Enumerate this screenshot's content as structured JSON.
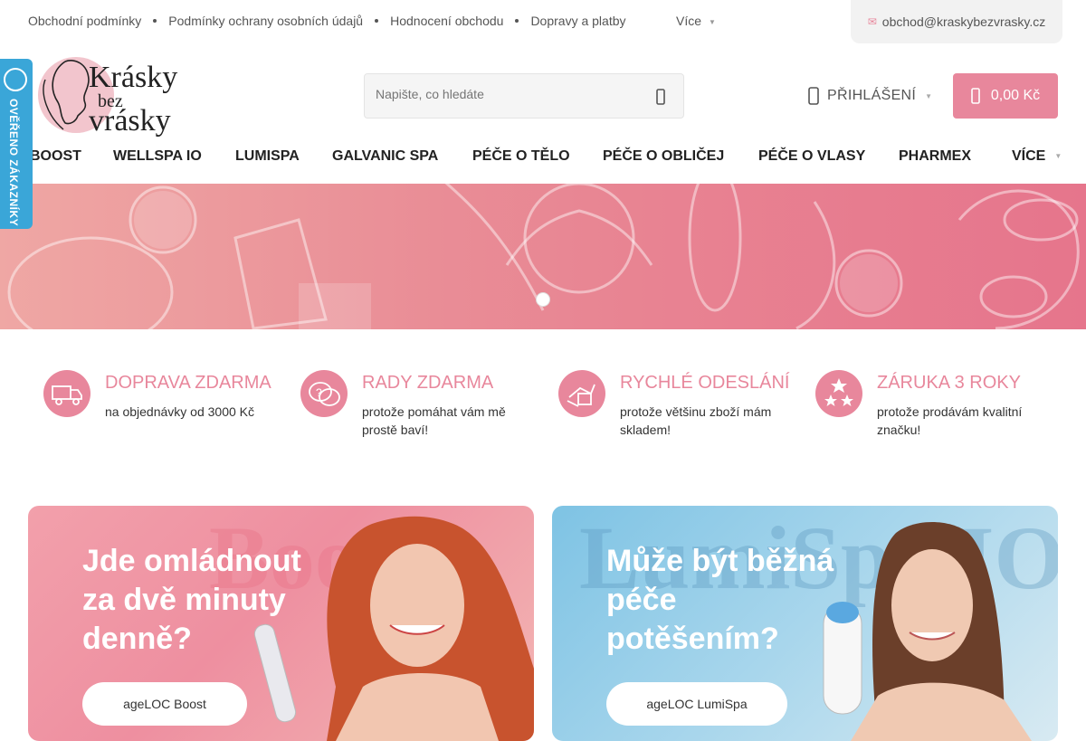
{
  "top_links": [
    "Obchodní podmínky",
    "Podmínky ochrany osobních údajů",
    "Hodnocení obchodu",
    "Dopravy a platby"
  ],
  "top_more": "Více",
  "email": "obchod@kraskybezvrasky.cz",
  "logo": {
    "line1": "Krásky",
    "line2": "bez",
    "line3": "vrásky"
  },
  "search": {
    "placeholder": "Napište, co hledáte"
  },
  "login": "PŘIHLÁŠENÍ",
  "cart": "0,00 Kč",
  "nav": [
    "BOOST",
    "WELLSPA IO",
    "LUMISPA",
    "GALVANIC SPA",
    "PÉČE O TĚLO",
    "PÉČE O OBLIČEJ",
    "PÉČE O VLASY",
    "PHARMEX",
    "VÍCE"
  ],
  "verified": "OVĚŘENO ZÁKAZNÍKY",
  "features": [
    {
      "title": "DOPRAVA ZDARMA",
      "text": "na objednávky od 3000 Kč",
      "icon": "truck-icon"
    },
    {
      "title": "RADY ZDARMA",
      "text": "protože pomáhat vám mě prostě baví!",
      "icon": "advice-icon"
    },
    {
      "title": "RYCHLÉ ODESLÁNÍ",
      "text": "protože většinu zboží mám skladem!",
      "icon": "shipping-icon"
    },
    {
      "title": "ZÁRUKA 3 ROKY",
      "text": "protože prodávám kvalitní značku!",
      "icon": "stars-icon"
    }
  ],
  "promos": [
    {
      "bg_word": "Boost",
      "headline_lines": [
        "Jde omládnout",
        "za dvě minuty",
        "denně?"
      ],
      "button": "ageLOC Boost"
    },
    {
      "bg_word": "LumiSpa IO",
      "headline_lines": [
        "Může být běžná",
        "péče",
        "potěšením?"
      ],
      "button": "ageLOC LumiSpa"
    }
  ],
  "colors": {
    "accent": "#e8879c",
    "verified_blue": "#3aa6d8"
  }
}
